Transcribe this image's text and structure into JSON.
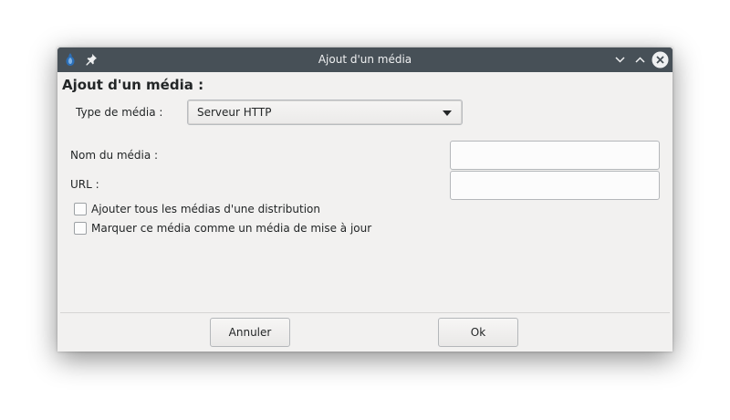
{
  "window": {
    "title": "Ajout d'un média",
    "titlebar_color": "#475057",
    "left_icons": [
      "app-icon",
      "pin-icon"
    ],
    "controls": [
      "minimize-icon",
      "maximize-icon",
      "close-icon"
    ]
  },
  "form": {
    "heading": "Ajout d'un média :",
    "media_type_label": "Type de média :",
    "media_type_value": "Serveur HTTP",
    "name_label": "Nom du média :",
    "name_value": "",
    "url_label": "URL :",
    "url_value": "",
    "checkboxes": [
      {
        "label": "Ajouter tous les médias d'une distribution",
        "checked": false
      },
      {
        "label": "Marquer ce média comme un média de mise à jour",
        "checked": false
      }
    ]
  },
  "buttons": {
    "cancel": "Annuler",
    "ok": "Ok"
  }
}
